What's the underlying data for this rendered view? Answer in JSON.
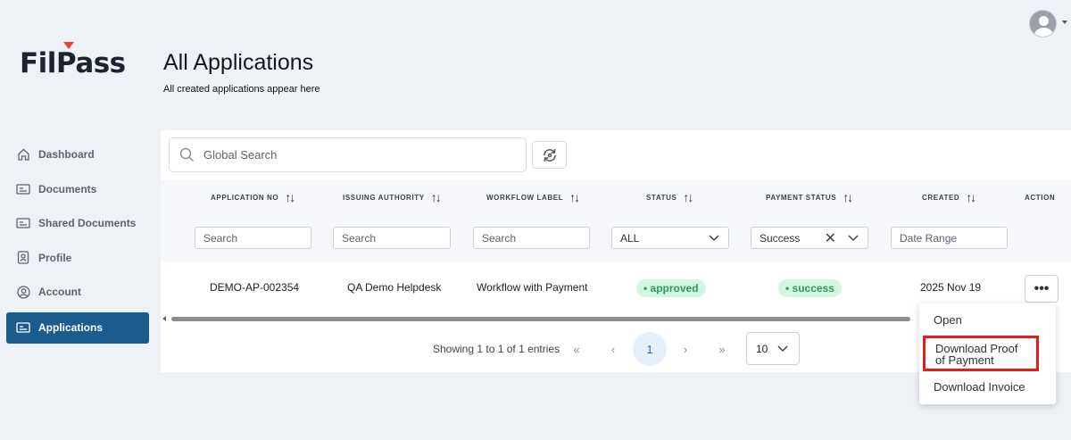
{
  "app": {
    "logo": "FilPass",
    "brand_accent": "#e0453c",
    "primary": "#1b5c8e"
  },
  "header": {
    "title": "All Applications",
    "subtitle": "All created applications appear here",
    "avatar_icon": "user-avatar-icon"
  },
  "sidebar": {
    "items": [
      {
        "label": "Dashboard",
        "icon": "home-icon",
        "active": false
      },
      {
        "label": "Documents",
        "icon": "document-icon",
        "active": false
      },
      {
        "label": "Shared Documents",
        "icon": "shared-document-icon",
        "active": false
      },
      {
        "label": "Profile",
        "icon": "profile-icon",
        "active": false
      },
      {
        "label": "Account",
        "icon": "account-icon",
        "active": false
      },
      {
        "label": "Applications",
        "icon": "applications-icon",
        "active": true
      }
    ]
  },
  "search": {
    "placeholder": "Global Search"
  },
  "table": {
    "columns": [
      {
        "label": "APPLICATION NO",
        "filter_placeholder": "Search"
      },
      {
        "label": "ISSUING AUTHORITY",
        "filter_placeholder": "Search"
      },
      {
        "label": "WORKFLOW LABEL",
        "filter_placeholder": "Search"
      },
      {
        "label": "STATUS",
        "filter_value": "ALL"
      },
      {
        "label": "PAYMENT STATUS",
        "filter_value": "Success"
      },
      {
        "label": "CREATED",
        "filter_placeholder": "Date Range"
      },
      {
        "label": "ACTION"
      }
    ],
    "rows": [
      {
        "application_no": "DEMO-AP-002354",
        "issuing_authority": "QA Demo Helpdesk",
        "workflow_label": "Workflow with Payment",
        "status": "• approved",
        "payment_status": "• success",
        "created": "2025 Nov 19",
        "action": "•••"
      }
    ]
  },
  "pagination": {
    "showing": "Showing 1 to 1 of 1 entries",
    "first": "«",
    "prev": "‹",
    "current": "1",
    "next": "›",
    "last": "»",
    "per_page": "10"
  },
  "action_menu": {
    "items": [
      "Open",
      "Download Proof of Payment",
      "Download Invoice"
    ],
    "highlighted": "Download Proof of Payment"
  }
}
